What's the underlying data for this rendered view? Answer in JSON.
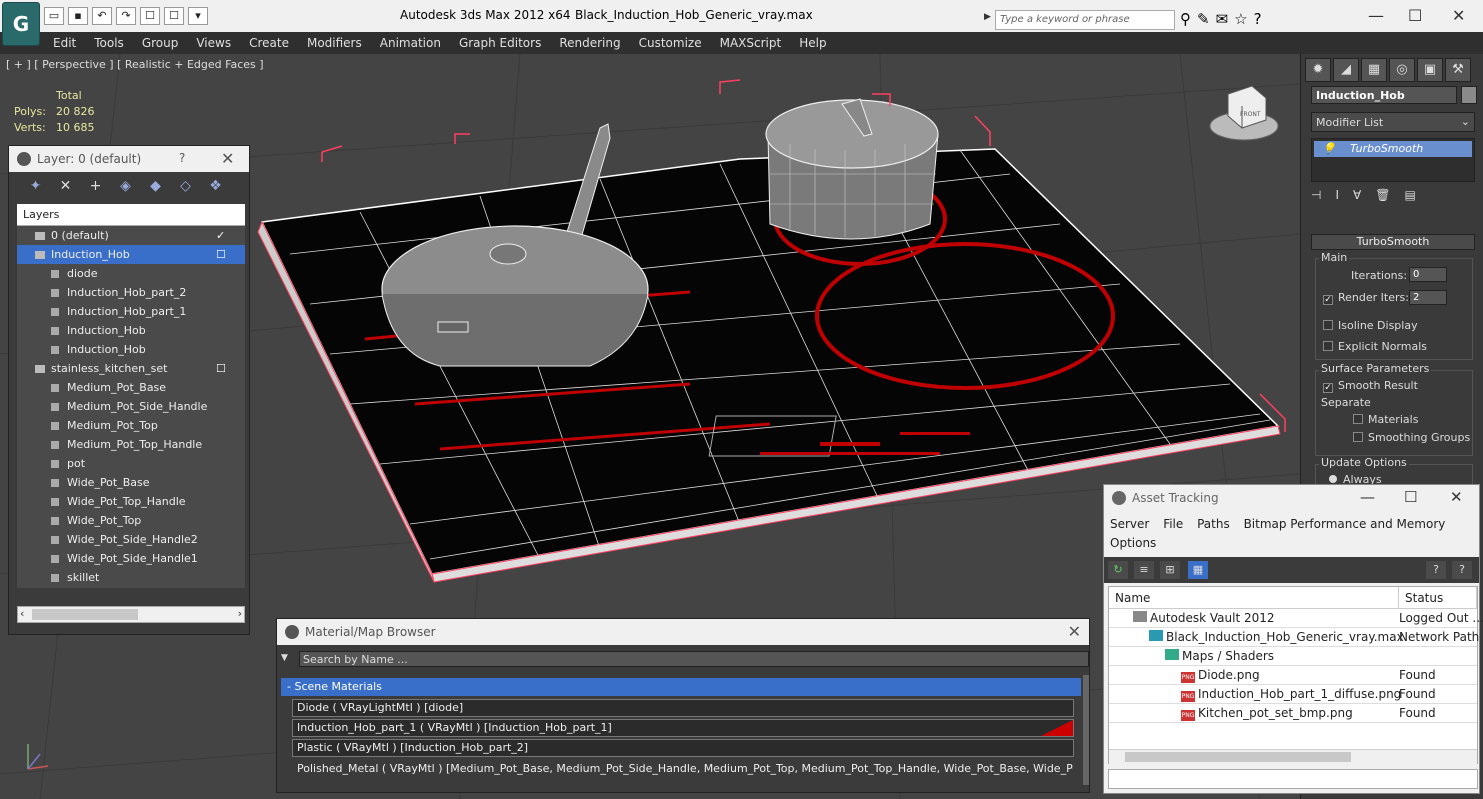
{
  "titlebar": {
    "app_title": "Autodesk 3ds Max  2012 x64",
    "file_name": "Black_Induction_Hob_Generic_vray.max",
    "search_placeholder": "Type a keyword or phrase",
    "logo_icon": "3dsmax-logo-icon"
  },
  "menu": [
    "Edit",
    "Tools",
    "Group",
    "Views",
    "Create",
    "Modifiers",
    "Animation",
    "Graph Editors",
    "Rendering",
    "Customize",
    "MAXScript",
    "Help"
  ],
  "viewport": {
    "label": "[ + ] [ Perspective ] [ Realistic + Edged Faces ]",
    "stats_header": "Total",
    "polys_label": "Polys:",
    "polys_value": "20 826",
    "verts_label": "Verts:",
    "verts_value": "10 685",
    "viewcube_label": "FRONT"
  },
  "layer_panel": {
    "title": "Layer: 0 (default)",
    "help": "?",
    "column_header": "Layers",
    "rows": [
      {
        "name": "0 (default)",
        "level": 0,
        "kind": "layer",
        "mark": "✓"
      },
      {
        "name": "Induction_Hob",
        "level": 0,
        "kind": "layer",
        "mark": "☐",
        "selected": true
      },
      {
        "name": "diode",
        "level": 1,
        "kind": "object"
      },
      {
        "name": "Induction_Hob_part_2",
        "level": 1,
        "kind": "object"
      },
      {
        "name": "Induction_Hob_part_1",
        "level": 1,
        "kind": "object"
      },
      {
        "name": "Induction_Hob",
        "level": 1,
        "kind": "object"
      },
      {
        "name": "Induction_Hob",
        "level": 1,
        "kind": "object"
      },
      {
        "name": "stainless_kitchen_set",
        "level": 0,
        "kind": "layer",
        "mark": "☐"
      },
      {
        "name": "Medium_Pot_Base",
        "level": 1,
        "kind": "object"
      },
      {
        "name": "Medium_Pot_Side_Handle",
        "level": 1,
        "kind": "object"
      },
      {
        "name": "Medium_Pot_Top",
        "level": 1,
        "kind": "object"
      },
      {
        "name": "Medium_Pot_Top_Handle",
        "level": 1,
        "kind": "object"
      },
      {
        "name": "pot",
        "level": 1,
        "kind": "object"
      },
      {
        "name": "Wide_Pot_Base",
        "level": 1,
        "kind": "object"
      },
      {
        "name": "Wide_Pot_Top_Handle",
        "level": 1,
        "kind": "object"
      },
      {
        "name": "Wide_Pot_Top",
        "level": 1,
        "kind": "object"
      },
      {
        "name": "Wide_Pot_Side_Handle2",
        "level": 1,
        "kind": "object"
      },
      {
        "name": "Wide_Pot_Side_Handle1",
        "level": 1,
        "kind": "object"
      },
      {
        "name": "skillet",
        "level": 1,
        "kind": "object"
      }
    ]
  },
  "command_panel": {
    "object_name": "Induction_Hob",
    "modifier_list": "Modifier List",
    "stack_item": "TurboSmooth",
    "rollout_title": "TurboSmooth",
    "main_group": "Main",
    "iterations_label": "Iterations:",
    "iterations_value": "0",
    "render_iters_label": "Render Iters:",
    "render_iters_value": "2",
    "isoline_label": "Isoline Display",
    "explicit_normals_label": "Explicit Normals",
    "surface_group": "Surface Parameters",
    "smooth_result_label": "Smooth Result",
    "separate_label": "Separate",
    "materials_label": "Materials",
    "smoothing_groups_label": "Smoothing Groups",
    "update_group": "Update Options",
    "always_label": "Always"
  },
  "material_browser": {
    "title": "Material/Map Browser",
    "search_placeholder": "Search by Name ...",
    "section": "- Scene Materials",
    "rows": [
      "Diode  ( VRayLightMtl )  [diode]",
      "Induction_Hob_part_1  ( VRayMtl )  [Induction_Hob_part_1]",
      "Plastic  ( VRayMtl )  [Induction_Hob_part_2]",
      "Polished_Metal  ( VRayMtl ) [Medium_Pot_Base, Medium_Pot_Side_Handle, Medium_Pot_Top, Medium_Pot_Top_Handle, Wide_Pot_Base, Wide_Pot_Si..."
    ]
  },
  "asset_tracking": {
    "title": "Asset Tracking",
    "menu": [
      "Server",
      "File",
      "Paths",
      "Bitmap Performance and Memory",
      "Options"
    ],
    "col_name": "Name",
    "col_status": "Status",
    "rows": [
      {
        "name": "Autodesk Vault 2012",
        "status": "Logged Out ...",
        "indent": 0,
        "icon": "vault-icon"
      },
      {
        "name": "Black_Induction_Hob_Generic_vray.max",
        "status": "Network Path",
        "indent": 1,
        "icon": "max-file-icon"
      },
      {
        "name": "Maps / Shaders",
        "status": "",
        "indent": 2,
        "icon": "maps-icon"
      },
      {
        "name": "Diode.png",
        "status": "Found",
        "indent": 3,
        "icon": "png-icon"
      },
      {
        "name": "Induction_Hob_part_1_diffuse.png",
        "status": "Found",
        "indent": 3,
        "icon": "png-icon"
      },
      {
        "name": "Kitchen_pot_set_bmp.png",
        "status": "Found",
        "indent": 3,
        "icon": "png-icon"
      }
    ]
  },
  "colors": {
    "accent": "#3a6fc9",
    "hob_red": "#c00000",
    "wire": "#ffffff",
    "selection_bracket": "#ff4060"
  }
}
